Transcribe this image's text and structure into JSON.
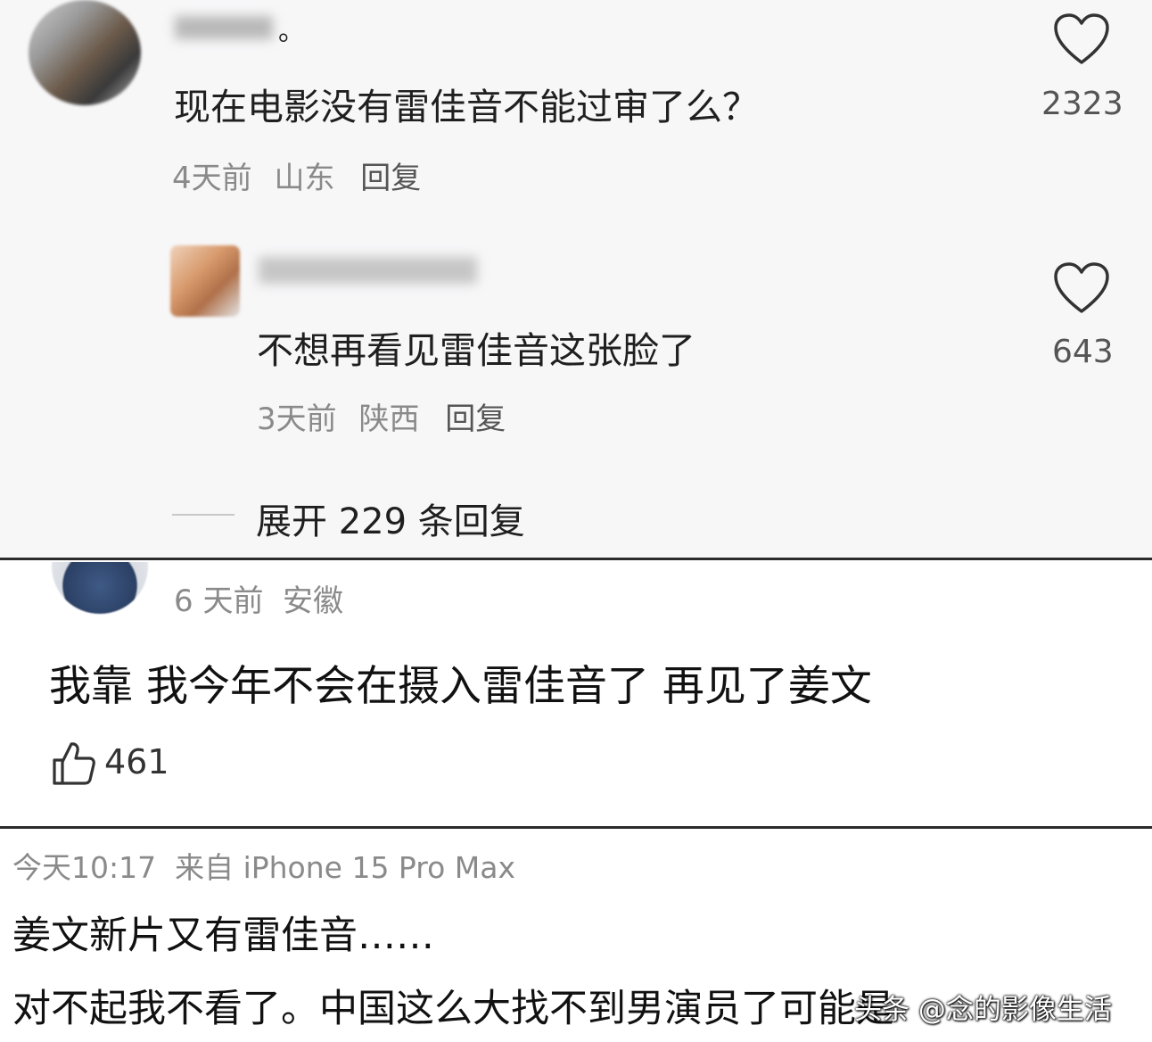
{
  "comment1": {
    "name_suffix": "。",
    "text": "现在电影没有雷佳音不能过审了么？",
    "time": "4天前",
    "location": "山东",
    "reply_label": "回复",
    "likes": "2323",
    "like_icon": "heart-icon"
  },
  "reply1": {
    "text": "不想再看见雷佳音这张脸了",
    "time": "3天前",
    "location": "陕西",
    "reply_label": "回复",
    "likes": "643",
    "like_icon": "heart-icon"
  },
  "expand_replies": "展开 229 条回复",
  "comment2": {
    "meta": "6 天前  安徽",
    "text": "我靠 我今年不会在摄入雷佳音了 再见了姜文",
    "likes": "461",
    "like_icon": "thumbs-up-icon"
  },
  "comment3": {
    "meta": "今天10:17  来自 iPhone 15 Pro Max",
    "line1": "姜文新片又有雷佳音……",
    "line2": "对不起我不看了。中国这么大找不到男演员了可能是"
  },
  "watermark": "头条 @念的影像生活",
  "colors": {
    "panel_gray": "#f7f7f8",
    "divider": "#2b2b2b",
    "meta_gray": "#8a8a8a",
    "text": "#1f1f1f"
  }
}
